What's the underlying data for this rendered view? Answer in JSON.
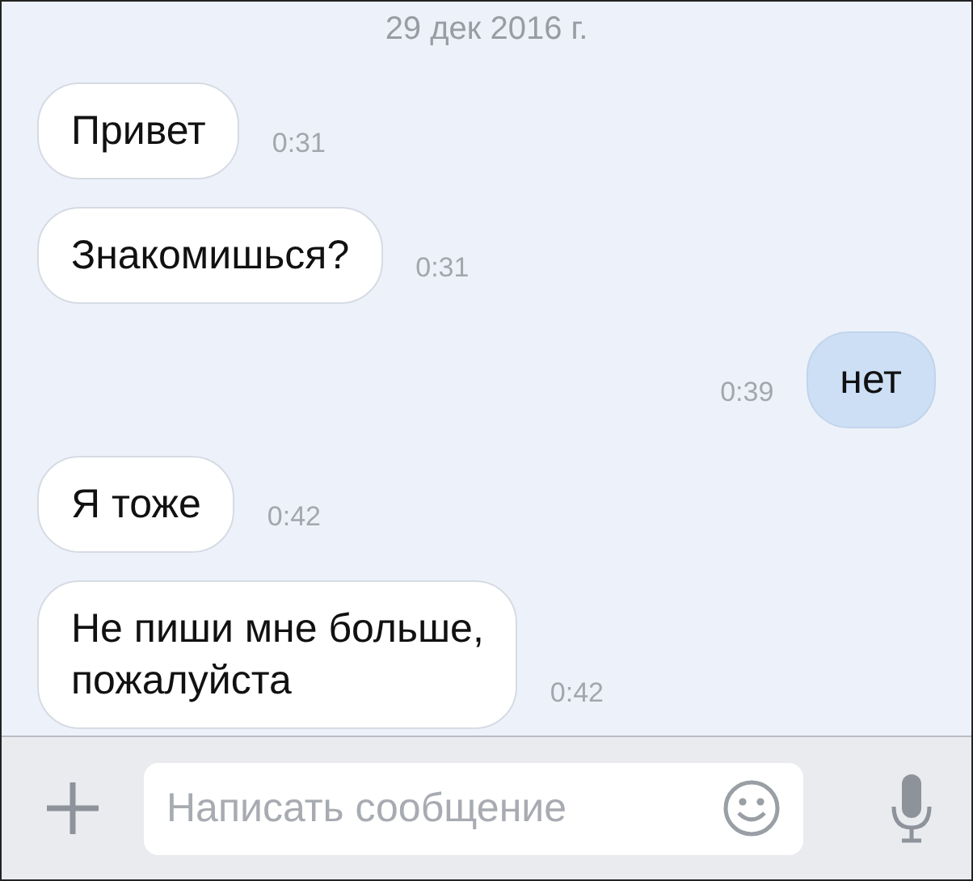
{
  "date_header": "29 дек 2016 г.",
  "messages": [
    {
      "kind": "incoming",
      "text": "Привет",
      "time": "0:31"
    },
    {
      "kind": "incoming",
      "text": "Знакомишься?",
      "time": "0:31"
    },
    {
      "kind": "outgoing",
      "text": "нет",
      "time": "0:39"
    },
    {
      "kind": "incoming",
      "text": "Я тоже",
      "time": "0:42"
    },
    {
      "kind": "incoming",
      "text": "Не пиши мне больше,\nпожалуйста",
      "time": "0:42"
    }
  ],
  "composer": {
    "placeholder": "Написать сообщение"
  }
}
